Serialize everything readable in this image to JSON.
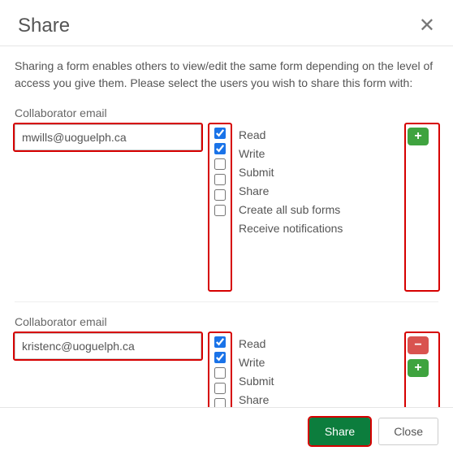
{
  "dialog": {
    "title": "Share",
    "description": "Sharing a form enables others to view/edit the same form depending on the level of access you give them. Please select the users you wish to share this form with:",
    "close_x": "✕"
  },
  "perm_labels": {
    "read": "Read",
    "write": "Write",
    "submit": "Submit",
    "share": "Share",
    "create_sub": "Create all sub forms",
    "receive_notif": "Receive notifications"
  },
  "collaborators": [
    {
      "field_label": "Collaborator email",
      "email": "mwills@uoguelph.ca",
      "read": true,
      "write": true,
      "submit": false,
      "share": false,
      "create_sub": false,
      "receive_notif": false,
      "show_remove": false
    },
    {
      "field_label": "Collaborator email",
      "email": "kristenc@uoguelph.ca",
      "read": true,
      "write": true,
      "submit": false,
      "share": false,
      "create_sub": false,
      "receive_notif": false,
      "show_remove": true
    }
  ],
  "icons": {
    "plus": "+",
    "minus": "−"
  },
  "footer": {
    "share": "Share",
    "close": "Close"
  }
}
